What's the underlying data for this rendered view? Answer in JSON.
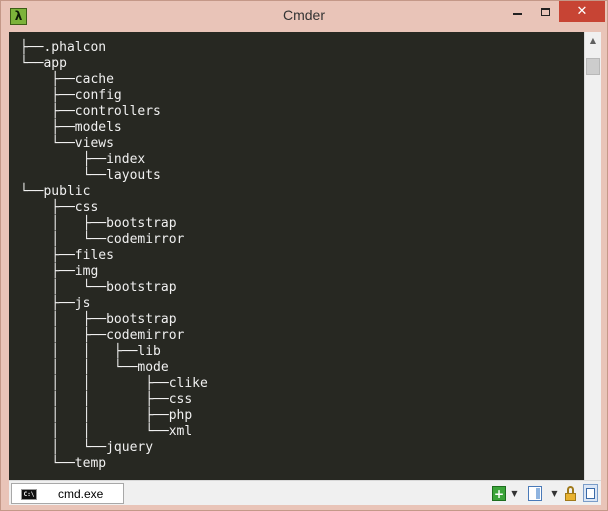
{
  "window": {
    "title": "Cmder",
    "app_icon_glyph": "λ",
    "close_glyph": "✕"
  },
  "colors": {
    "titlebar": "#e9c4b8",
    "terminal_bg": "#272822",
    "terminal_fg": "#f0f0f0",
    "close_button": "#c74434"
  },
  "terminal": {
    "lines": [
      "├──.phalcon",
      "└──app",
      "    ├──cache",
      "    ├──config",
      "    ├──controllers",
      "    ├──models",
      "    └──views",
      "        ├──index",
      "        └──layouts",
      "└──public",
      "    ├──css",
      "    │   ├──bootstrap",
      "    │   └──codemirror",
      "    ├──files",
      "    ├──img",
      "    │   └──bootstrap",
      "    ├──js",
      "    │   ├──bootstrap",
      "    │   ├──codemirror",
      "    │   │   ├──lib",
      "    │   │   └──mode",
      "    │   │       ├──clike",
      "    │   │       ├──css",
      "    │   │       ├──php",
      "    │   │       └──xml",
      "    │   └──jquery",
      "    └──temp"
    ]
  },
  "statusbar": {
    "tab_label": "cmd.exe",
    "tab_icon_glyph": "C:\\",
    "new_console_glyph": "+",
    "dropdown_glyph": "▼",
    "icons": [
      "new-console-icon",
      "view-icon",
      "lock-icon",
      "console-icon"
    ]
  }
}
